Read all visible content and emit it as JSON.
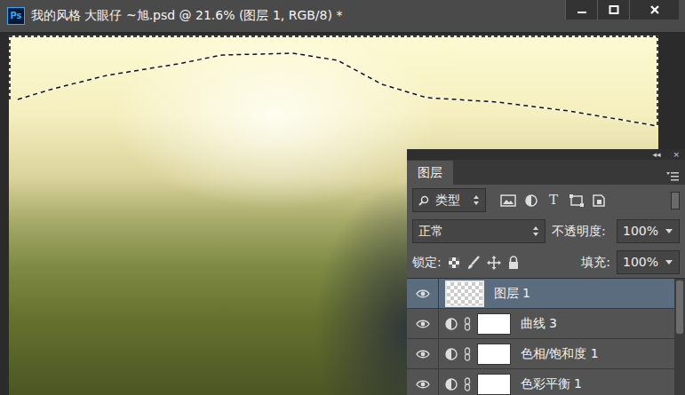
{
  "window": {
    "app_logo": "Ps",
    "title": "我的风格 大眼仔 ~旭.psd @ 21.6% (图层 1, RGB/8) *"
  },
  "canvas": {
    "selection_active": true
  },
  "layers_panel": {
    "collapse": "◂◂",
    "close": "×",
    "tabs": [
      {
        "label": "图层",
        "selected": true
      }
    ],
    "filter": {
      "label": "类型",
      "text_icon": "T"
    },
    "blend_mode": "正常",
    "opacity": {
      "label": "不透明度:",
      "value": "100%"
    },
    "lock": {
      "label": "锁定:"
    },
    "fill": {
      "label": "填充:",
      "value": "100%"
    },
    "layers": [
      {
        "name": "图层 1",
        "kind": "pixel",
        "visible": true,
        "selected": true
      },
      {
        "name": "曲线 3",
        "kind": "adjustment",
        "visible": true,
        "selected": false
      },
      {
        "name": "色相/饱和度 1",
        "kind": "adjustment",
        "visible": true,
        "selected": false
      },
      {
        "name": "色彩平衡 1",
        "kind": "adjustment",
        "visible": true,
        "selected": false
      }
    ]
  }
}
